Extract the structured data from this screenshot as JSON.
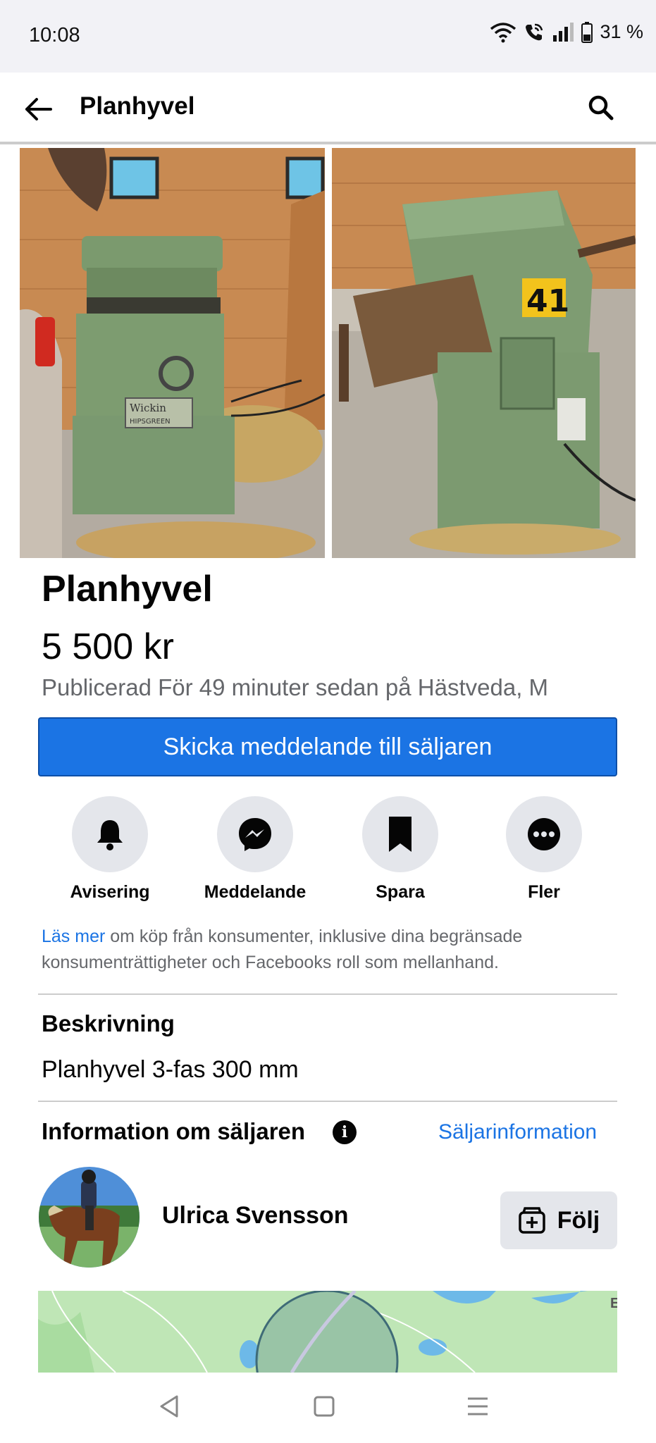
{
  "status_bar": {
    "time": "10:08",
    "battery": "31 %"
  },
  "app_bar": {
    "title": "Planhyvel"
  },
  "listing": {
    "title": "Planhyvel",
    "price": "5 500 kr",
    "published": "Publicerad För 49 minuter sedan på Hästveda, M",
    "contact_button": "Skicka meddelande till säljaren",
    "photo_labels": {
      "brand": "Wickin",
      "brand_sub": "HIPSGREEN",
      "number": "41"
    }
  },
  "actions": [
    {
      "label": "Avisering",
      "icon": "bell-icon"
    },
    {
      "label": "Meddelande",
      "icon": "messenger-icon"
    },
    {
      "label": "Spara",
      "icon": "bookmark-icon"
    },
    {
      "label": "Fler",
      "icon": "more-icon"
    }
  ],
  "legal": {
    "link": "Läs mer",
    "text": " om köp från konsumenter, inklusive dina begränsade konsumenträttigheter och Facebooks roll som mellanhand."
  },
  "description": {
    "heading": "Beskrivning",
    "text": "Planhyvel 3-fas 300 mm"
  },
  "seller": {
    "heading": "Information om säljaren",
    "link": "Säljarinformation",
    "name": "Ulrica Svensson",
    "follow_label": "Följ"
  },
  "map": {
    "edge_label": "E"
  },
  "colors": {
    "accent": "#1b74e4",
    "secondary_text": "#65676b",
    "chip_bg": "#e4e6eb"
  }
}
